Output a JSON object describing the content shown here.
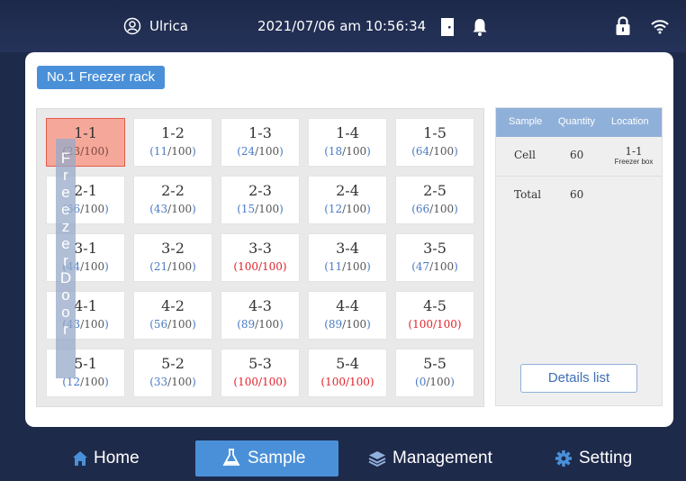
{
  "status_bar": {
    "user": "Ulrica",
    "datetime": "2021/07/06 am 10:56:34",
    "icons": [
      "user-icon",
      "door-icon",
      "bell-icon",
      "lock-icon",
      "wifi-icon"
    ]
  },
  "rack_title": "No.1 Freezer rack",
  "door_label": [
    "F",
    "r",
    "e",
    "e",
    "z",
    "e",
    "r",
    "D",
    "o",
    "o",
    "r"
  ],
  "grid": [
    [
      {
        "name": "1-1",
        "used": "23",
        "cap": "/100",
        "full": false,
        "selected": true
      },
      {
        "name": "1-2",
        "used": "11",
        "cap": "/100",
        "full": false
      },
      {
        "name": "1-3",
        "used": "24",
        "cap": "/100",
        "full": false
      },
      {
        "name": "1-4",
        "used": "18",
        "cap": "/100",
        "full": false
      },
      {
        "name": "1-5",
        "used": "64",
        "cap": "/100",
        "full": false
      }
    ],
    [
      {
        "name": "2-1",
        "used": "66",
        "cap": "/100",
        "full": false
      },
      {
        "name": "2-2",
        "used": "43",
        "cap": "/100",
        "full": false
      },
      {
        "name": "2-3",
        "used": "15",
        "cap": "/100",
        "full": false
      },
      {
        "name": "2-4",
        "used": "12",
        "cap": "/100",
        "full": false
      },
      {
        "name": "2-5",
        "used": "66",
        "cap": "/100",
        "full": false
      }
    ],
    [
      {
        "name": "3-1",
        "used": "44",
        "cap": "/100",
        "full": false
      },
      {
        "name": "3-2",
        "used": "21",
        "cap": "/100",
        "full": false
      },
      {
        "name": "3-3",
        "used": "100",
        "cap": "/100",
        "full": true
      },
      {
        "name": "3-4",
        "used": "11",
        "cap": "/100",
        "full": false
      },
      {
        "name": "3-5",
        "used": "47",
        "cap": "/100",
        "full": false
      }
    ],
    [
      {
        "name": "4-1",
        "used": "43",
        "cap": "/100",
        "full": false
      },
      {
        "name": "4-2",
        "used": "56",
        "cap": "/100",
        "full": false
      },
      {
        "name": "4-3",
        "used": "89",
        "cap": "/100",
        "full": false
      },
      {
        "name": "4-4",
        "used": "89",
        "cap": "/100",
        "full": false
      },
      {
        "name": "4-5",
        "used": "100",
        "cap": "/100",
        "full": true
      }
    ],
    [
      {
        "name": "5-1",
        "used": "12",
        "cap": "/100",
        "full": false
      },
      {
        "name": "5-2",
        "used": "33",
        "cap": "/100",
        "full": false
      },
      {
        "name": "5-3",
        "used": "100",
        "cap": "/100",
        "full": true
      },
      {
        "name": "5-4",
        "used": "100",
        "cap": "/100",
        "full": true
      },
      {
        "name": "5-5",
        "used": "0",
        "cap": "/100",
        "full": false
      }
    ]
  ],
  "info_table": {
    "headers": {
      "sample": "Sample",
      "quantity": "Quantity",
      "location": "Location"
    },
    "row": {
      "sample": "Cell",
      "quantity": "60",
      "location": "1-1",
      "location_sub": "Freezer box"
    },
    "total": {
      "label": "Total",
      "quantity": "60"
    }
  },
  "details_button": "Details list",
  "nav": {
    "home": "Home",
    "sample": "Sample",
    "management": "Management",
    "setting": "Setting",
    "active": "sample"
  },
  "colors": {
    "accent": "#4a90d9",
    "background": "#1e2a4a",
    "full": "#e0232b",
    "selected": "#f5a89a"
  }
}
